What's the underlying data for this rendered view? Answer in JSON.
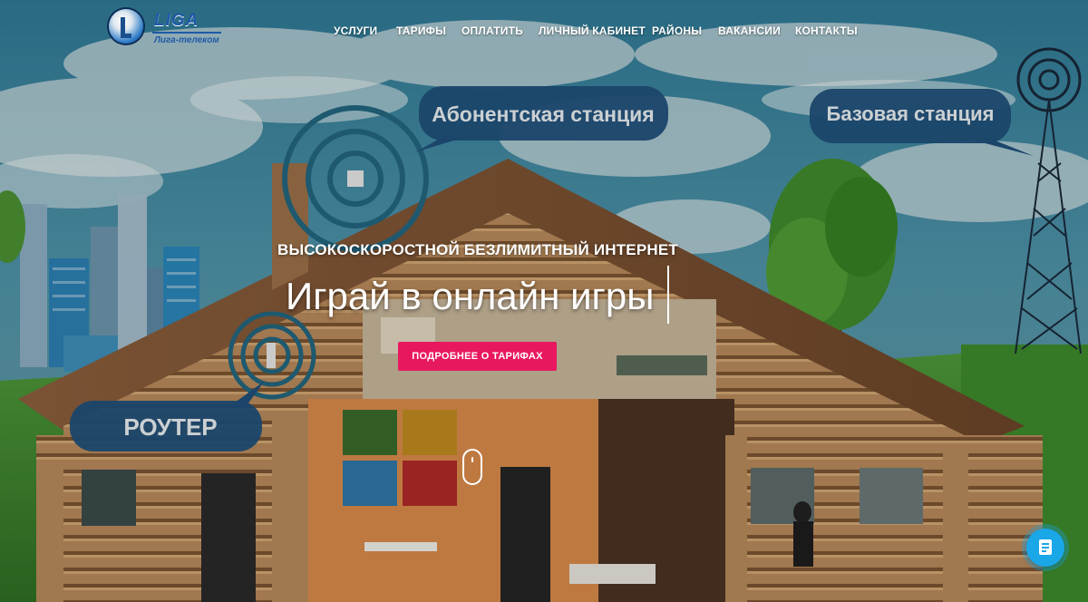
{
  "brand": {
    "name": "LIGA",
    "subtitle": "Лига-телеком"
  },
  "nav": {
    "items": [
      {
        "label": "УСЛУГИ"
      },
      {
        "label": "ТАРИФЫ"
      },
      {
        "label": "ОПЛАТИТЬ"
      },
      {
        "label": "ЛИЧНЫЙ КАБИНЕТ"
      },
      {
        "label": "РАЙОНЫ"
      },
      {
        "label": "ВАКАНСИИ"
      },
      {
        "label": "КОНТАКТЫ"
      }
    ]
  },
  "hero": {
    "headline": "ВЫСОКОСКОРОСТНОЙ БЕЗЛИМИТНЫЙ ИНТЕРНЕТ",
    "typed_text": "Играй в онлайн игры",
    "cta_label": "ПОДРОБНЕЕ О ТАРИФАХ",
    "illustration_labels": {
      "subscriber_station": "Абонентская станция",
      "base_station": "Базовая станция",
      "router": "РОУТЕР"
    }
  },
  "colors": {
    "accent": "#e8185f",
    "chat_button": "#1aa7e8",
    "bubble": "#1f4f7a",
    "logo_blue": "#1e5aa8"
  },
  "icons": {
    "chat_widget": "document-icon",
    "scroll": "mouse-scroll-icon"
  }
}
